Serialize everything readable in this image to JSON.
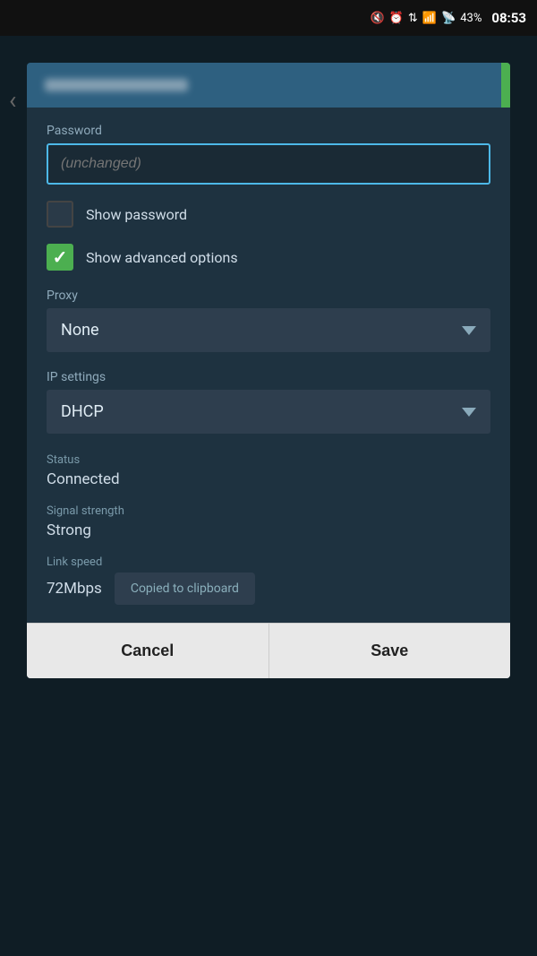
{
  "statusBar": {
    "time": "08:53",
    "battery": "43%",
    "icons": [
      "mute",
      "alarm",
      "sync",
      "wifi",
      "signal"
    ]
  },
  "dialog": {
    "header": {
      "greenBar": true
    },
    "password": {
      "label": "Password",
      "placeholder": "(unchanged)"
    },
    "showPassword": {
      "label": "Show password",
      "checked": false
    },
    "showAdvanced": {
      "label": "Show advanced options",
      "checked": true
    },
    "proxy": {
      "label": "Proxy",
      "value": "None"
    },
    "ipSettings": {
      "label": "IP settings",
      "value": "DHCP"
    },
    "status": {
      "label": "Status",
      "value": "Connected"
    },
    "signalStrength": {
      "label": "Signal strength",
      "value": "Strong"
    },
    "linkSpeed": {
      "label": "Link speed",
      "value": "72Mbps"
    },
    "clipboard": {
      "text": "Copied to clipboard"
    },
    "cancelBtn": "Cancel",
    "saveBtn": "Save"
  },
  "backArrow": "‹"
}
